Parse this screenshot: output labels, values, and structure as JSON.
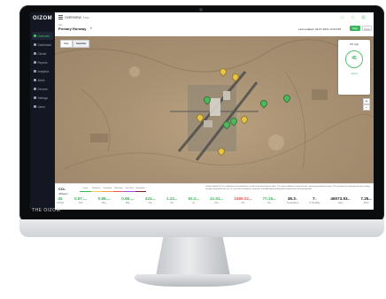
{
  "app": {
    "logo": "OIZOM",
    "bezel_brand": "THE OIZOM"
  },
  "sidebar": {
    "items": [
      {
        "label": "Overview",
        "active": true
      },
      {
        "label": "Dashboard",
        "active": false
      },
      {
        "label": "Cluster",
        "active": false
      },
      {
        "label": "Reports",
        "active": false
      },
      {
        "label": "Analytics",
        "active": false
      },
      {
        "label": "Alerts",
        "active": false
      },
      {
        "label": "Devices",
        "active": false
      },
      {
        "label": "Settings",
        "active": false
      },
      {
        "label": "Users",
        "active": false
      }
    ]
  },
  "topbar": {
    "title": "OVERVIEW",
    "subtitle": "Map"
  },
  "subbar": {
    "site_label": "Site",
    "site_value": "Primary Runway",
    "last_updated": "Last updated: 04-07-2021 13:04 PM",
    "map_button": "Map",
    "table_button": "Table"
  },
  "map": {
    "tabs": [
      "Map",
      "Satellite"
    ],
    "active_tab": "Satellite",
    "zoom_in": "+",
    "zoom_out": "−"
  },
  "aqi": {
    "title": "US AQI",
    "value": "45",
    "status": "Good",
    "color": "#3cb65b"
  },
  "pins": [
    {
      "color": "#e8c547"
    },
    {
      "color": "#e8c547"
    },
    {
      "color": "#e8c547"
    },
    {
      "color": "#4fb85c"
    },
    {
      "color": "#4fb85c"
    },
    {
      "color": "#4fb85c"
    },
    {
      "color": "#4fb85c"
    },
    {
      "color": "#e8c547"
    },
    {
      "color": "#e8c547"
    },
    {
      "color": "#4fb85c"
    }
  ],
  "info": {
    "pollutant": "CO₂",
    "value": "405ppm",
    "scale": [
      {
        "label": "Good",
        "color": "#3cb65b"
      },
      {
        "label": "Moderate",
        "color": "#f2c94c"
      },
      {
        "label": "Unhealthy",
        "color": "#f2994a"
      },
      {
        "label": "Unhealthy",
        "color": "#eb5757"
      },
      {
        "label": "Very Unhl.",
        "color": "#9b51e0"
      },
      {
        "label": "Hazardous",
        "color": "#7a1f2b"
      }
    ],
    "description": "Carbon dioxide (CO₂) contributes to air pollution in its role in the greenhouse effect. CO₂ traps radiation at ground level, creating ground-level ozone. This prevents the atmosphere from cooling at night. Elevated levels of CO₂ can cause headaches, dizziness and difficulty breathing when exposed for extended periods."
  },
  "metrics": [
    {
      "value": "45",
      "unit": "",
      "label": "US AQI",
      "color": "#3cb65b"
    },
    {
      "value": "0.87",
      "unit": "μg/m³",
      "label": "PM₁",
      "color": "#3cb65b"
    },
    {
      "value": "0.88",
      "unit": "μg/m³",
      "label": "PM₂.₅",
      "color": "#3cb65b"
    },
    {
      "value": "0.88",
      "unit": "μg/m³",
      "label": "PM₁₀",
      "color": "#3cb65b"
    },
    {
      "value": "423",
      "unit": "ppm",
      "label": "CO₂",
      "color": "#3cb65b"
    },
    {
      "value": "1.23",
      "unit": "ppb",
      "label": "CO",
      "color": "#3cb65b"
    },
    {
      "value": "92.2",
      "unit": "ppb",
      "label": "O₃",
      "color": "#3cb65b"
    },
    {
      "value": "41.02",
      "unit": "ppb",
      "label": "NO₂",
      "color": "#3cb65b"
    },
    {
      "value": "2489.02",
      "unit": "ppb",
      "label": "NO",
      "color": "#eb5757"
    },
    {
      "value": "77.16",
      "unit": "ppb",
      "label": "SO₂",
      "color": "#3cb65b"
    },
    {
      "value": "39.3",
      "unit": "°C",
      "label": "Temperature",
      "color": "#222222"
    },
    {
      "value": "7",
      "unit": "%",
      "label": "% Humidity",
      "color": "#222222"
    },
    {
      "value": "46073.93",
      "unit": "lux",
      "label": "Light",
      "color": "#222222"
    },
    {
      "value": "7.25",
      "unit": "m/s",
      "label": "Wind",
      "color": "#222222"
    }
  ]
}
